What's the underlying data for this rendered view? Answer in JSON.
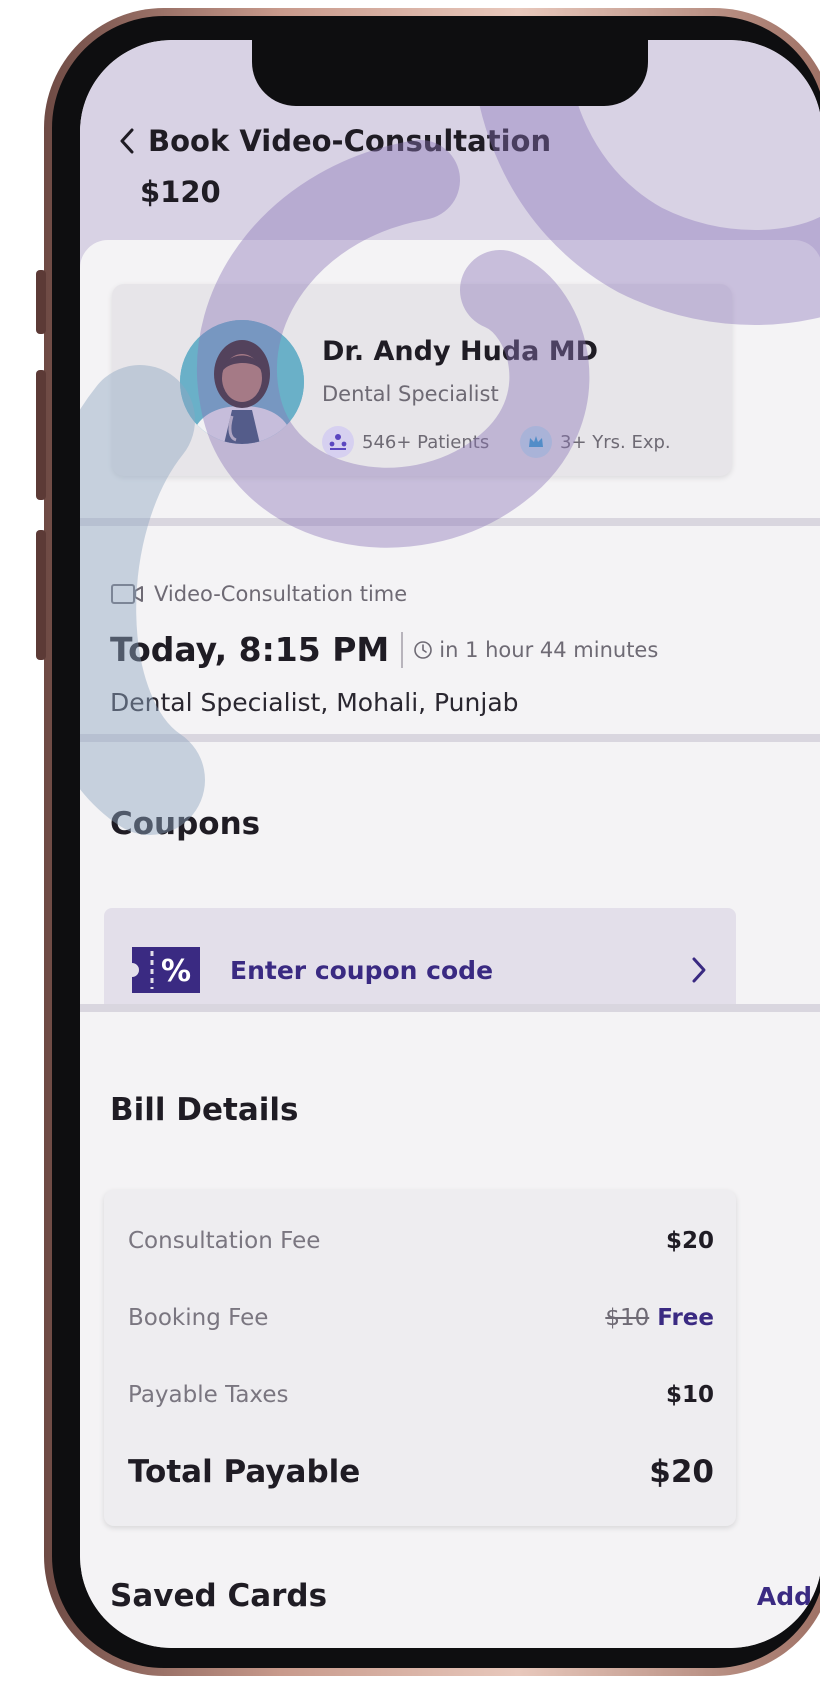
{
  "header": {
    "title": "Book Video-Consultation",
    "price": "$120"
  },
  "doctor": {
    "name": "Dr. Andy Huda MD",
    "specialty": "Dental Specialist",
    "patients": "546+ Patients",
    "experience": "3+ Yrs. Exp."
  },
  "appointment": {
    "label": "Video-Consultation time",
    "time": "Today, 8:15 PM",
    "relative": "in 1 hour 44 minutes",
    "location": "Dental Specialist, Mohali, Punjab"
  },
  "coupons": {
    "title": "Coupons",
    "placeholder": "Enter coupon code"
  },
  "bill": {
    "title": "Bill Details",
    "rows": [
      {
        "label": "Consultation Fee",
        "value": "$20"
      },
      {
        "label": "Booking Fee",
        "original": "$10",
        "value": "Free"
      },
      {
        "label": "Payable Taxes",
        "value": "$10"
      }
    ],
    "total_label": "Total Payable",
    "total_value": "$20"
  },
  "saved_cards": {
    "title": "Saved Cards",
    "action": "Add"
  },
  "colors": {
    "accent": "#3a2a82",
    "top_band": "#d8d2e4",
    "watermark_purple": "#8a74b8",
    "watermark_blue": "#8fa6c0"
  },
  "icons": [
    "back-icon",
    "patients-icon",
    "experience-icon",
    "video-camera-icon",
    "clock-icon",
    "coupon-icon",
    "chevron-right-icon"
  ]
}
